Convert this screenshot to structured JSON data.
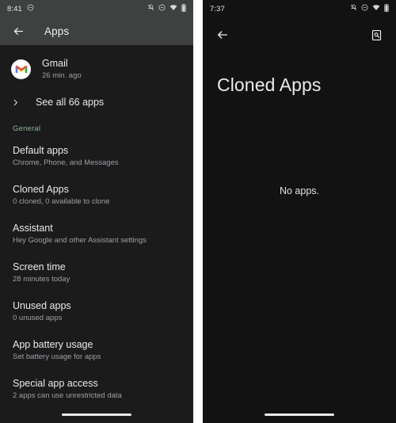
{
  "left_screen": {
    "status_bar": {
      "time": "8:41",
      "left_icons": [
        "dnd-icon"
      ],
      "right_icons": [
        "vibrate-off-icon",
        "dnd-icon",
        "wifi-icon",
        "battery-icon"
      ]
    },
    "app_bar": {
      "back_label": "Back",
      "title": "Apps"
    },
    "recent_app": {
      "icon": "gmail-icon",
      "name": "Gmail",
      "subtitle": "26 min. ago"
    },
    "see_all": {
      "icon": "chevron-right-icon",
      "label": "See all 66 apps"
    },
    "section_label": "General",
    "section_color": "#8eb49a",
    "items": [
      {
        "title": "Default apps",
        "subtitle": "Chrome, Phone, and Messages"
      },
      {
        "title": "Cloned Apps",
        "subtitle": "0 cloned, 0 available to clone"
      },
      {
        "title": "Assistant",
        "subtitle": "Hey Google and other Assistant settings"
      },
      {
        "title": "Screen time",
        "subtitle": "28 minutes today"
      },
      {
        "title": "Unused apps",
        "subtitle": "0 unused apps"
      },
      {
        "title": "App battery usage",
        "subtitle": "Set battery usage for apps"
      },
      {
        "title": "Special app access",
        "subtitle": "2 apps can use unrestricted data"
      }
    ]
  },
  "right_screen": {
    "status_bar": {
      "time": "7:37",
      "right_icons": [
        "vibrate-off-icon",
        "dnd-icon",
        "wifi-icon",
        "battery-icon"
      ]
    },
    "app_bar": {
      "back_label": "Back",
      "action_icon": "document-search-icon"
    },
    "title": "Cloned Apps",
    "empty_message": "No apps."
  },
  "theme": {
    "background": "#121212",
    "surface": "#1b1b1b",
    "appbar_surface": "#3e4140",
    "text_primary": "#e8eaed",
    "text_secondary": "#9aa0a6",
    "accent_green": "#8eb49a",
    "divider": "#ffffff"
  }
}
